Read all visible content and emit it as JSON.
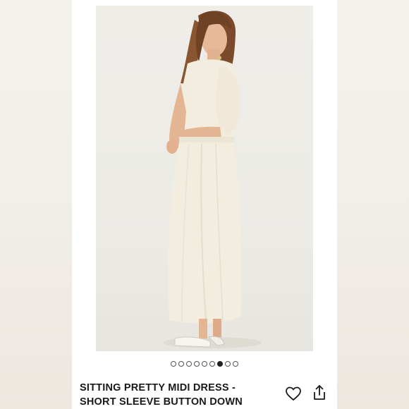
{
  "product": {
    "title_line1": "SITTING PRETTY MIDI DRESS -",
    "title_line2": "SHORT SLEEVE BUTTON DOWN",
    "image_alt": "Model wearing cream short sleeve midi dress",
    "dress_color": "#f3eddf"
  },
  "carousel": {
    "total": 9,
    "active_index": 6
  },
  "actions": {
    "favorite_icon": "heart-icon",
    "share_icon": "share-icon"
  }
}
